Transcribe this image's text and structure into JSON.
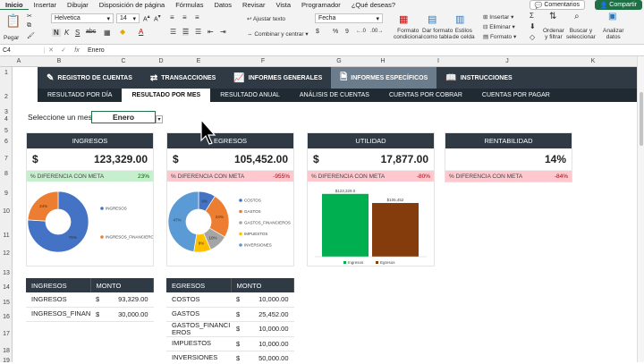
{
  "menu": [
    "Inicio",
    "Insertar",
    "Dibujar",
    "Disposición de página",
    "Fórmulas",
    "Datos",
    "Revisar",
    "Vista",
    "Programador",
    "¿Qué deseas?"
  ],
  "menu_active": "Inicio",
  "comments_label": "Comentarios",
  "share_label": "Compartir",
  "ribbon": {
    "paste": "Pegar",
    "font": "Helvetica",
    "size": "14",
    "wrap": "Ajustar texto",
    "merge": "Combinar y centrar",
    "number_format": "Fecha",
    "conditional": "Formato\ncondicional",
    "as_table": "Dar formato\ncomo tabla",
    "cell_styles": "Estilos\nde celda",
    "insert": "Insertar",
    "delete": "Eliminar",
    "format": "Formato",
    "sort": "Ordenar\ny filtrar",
    "find": "Buscar y\nseleccionar",
    "analyze": "Analizar\ndatos",
    "bold": "N",
    "italic": "K",
    "underline": "S",
    "strike": "abc",
    "currency": "$",
    "percent": "%",
    "comma": "9"
  },
  "formula": {
    "cell_ref": "C4",
    "fx": "fx",
    "value": "Enero"
  },
  "columns": [
    "A",
    "B",
    "C",
    "D",
    "E",
    "F",
    "G",
    "H",
    "I",
    "J",
    "K"
  ],
  "rows": [
    "1",
    "2",
    "3",
    "4",
    "5",
    "6",
    "7",
    "8",
    "9",
    "10",
    "11",
    "12",
    "13",
    "14",
    "15",
    "16",
    "17",
    "18",
    "19"
  ],
  "nav": [
    {
      "label": "REGISTRO DE CUENTAS",
      "icon": "edit-icon"
    },
    {
      "label": "TRANSACCIONES",
      "icon": "transactions-icon"
    },
    {
      "label": "INFORMES GENERALES",
      "icon": "chart-icon"
    },
    {
      "label": "INFORMES ESPECÍFICOS",
      "icon": "document-icon",
      "active": true
    },
    {
      "label": "INSTRUCCIONES",
      "icon": "book-icon"
    }
  ],
  "subnav": [
    {
      "label": "RESULTADO POR DÍA"
    },
    {
      "label": "RESULTADO POR MES",
      "active": true
    },
    {
      "label": "RESULTADO ANUAL"
    },
    {
      "label": "ANÁLISIS DE CUENTAS"
    },
    {
      "label": "CUENTAS POR COBRAR"
    },
    {
      "label": "CUENTAS POR PAGAR"
    }
  ],
  "month_label": "Seleccione un mes",
  "month_value": "Enero",
  "cards": {
    "ingresos": {
      "title": "INGRESOS",
      "currency": "$",
      "value": "123,329.00",
      "meta_label": "% DIFERENCIA CON META",
      "meta_pct": "23%"
    },
    "egresos": {
      "title": "EGRESOS",
      "currency": "$",
      "value": "105,452.00",
      "meta_label": "% DIFERENCIA CON META",
      "meta_pct": "-955%"
    },
    "utilidad": {
      "title": "UTILIDAD",
      "currency": "$",
      "value": "17,877.00",
      "meta_label": "% DIFERENCIA CON META",
      "meta_pct": "-80%"
    },
    "rentabilidad": {
      "title": "RENTABILIDAD",
      "value": "14%",
      "meta_label": "% DIFERENCIA CON META",
      "meta_pct": "-84%"
    }
  },
  "chart_data": [
    {
      "type": "pie",
      "variant": "donut",
      "labels": [
        "INGRESOS",
        "INGRESOS_FINANCIEROS"
      ],
      "values": [
        76,
        24
      ],
      "data_labels": [
        "76%",
        "24%"
      ],
      "colors": [
        "#4472c4",
        "#ed7d31"
      ],
      "legend": "right"
    },
    {
      "type": "pie",
      "variant": "donut",
      "labels": [
        "COSTOS",
        "GASTOS",
        "GASTOS_FINANCIEROS",
        "IMPUESTOS",
        "INVERSIONES"
      ],
      "values": [
        9,
        24,
        10,
        9,
        47
      ],
      "data_labels": [
        "9%",
        "24%",
        "10%",
        "9%",
        "47%"
      ],
      "colors": [
        "#4472c4",
        "#ed7d31",
        "#a5a5a5",
        "#ffc000",
        "#5b9bd5"
      ],
      "legend": "right"
    },
    {
      "type": "bar",
      "categories": [
        "Ingresos",
        "Egresos"
      ],
      "values": [
        123329,
        105452
      ],
      "data_labels": [
        "$123,329.0",
        "$105,452"
      ],
      "colors": [
        "#00b050",
        "#843c0c"
      ],
      "ylim": [
        0,
        130000
      ],
      "legend": "bottom"
    }
  ],
  "ingresos_table": {
    "headers": [
      "INGRESOS",
      "MONTO"
    ],
    "rows": [
      {
        "name": "INGRESOS",
        "cur": "$",
        "amount": "93,329.00"
      },
      {
        "name": "INGRESOS_FINANC",
        "cur": "$",
        "amount": "30,000.00"
      }
    ]
  },
  "egresos_table": {
    "headers": [
      "EGRESOS",
      "MONTO"
    ],
    "rows": [
      {
        "name": "COSTOS",
        "cur": "$",
        "amount": "10,000.00"
      },
      {
        "name": "GASTOS",
        "cur": "$",
        "amount": "25,452.00"
      },
      {
        "name": "GASTOS_FINANCI\nEROS",
        "cur": "$",
        "amount": "10,000.00"
      },
      {
        "name": "IMPUESTOS",
        "cur": "$",
        "amount": "10,000.00"
      },
      {
        "name": "INVERSIONES",
        "cur": "$",
        "amount": "50,000.00"
      }
    ]
  }
}
